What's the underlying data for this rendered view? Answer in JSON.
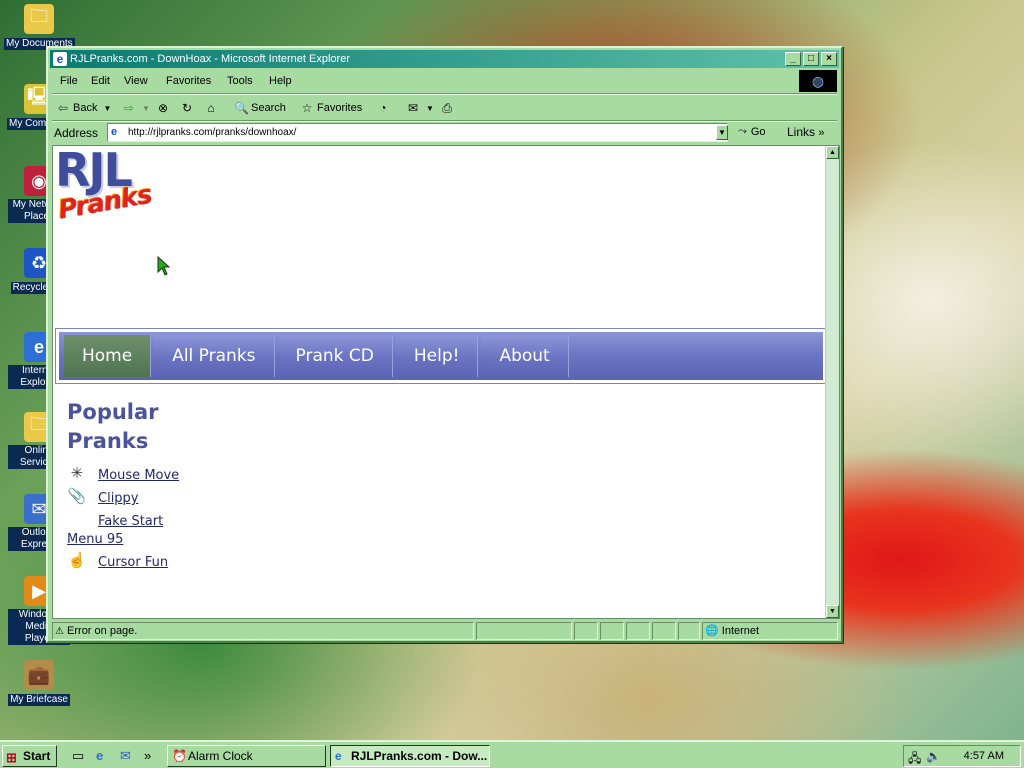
{
  "desktop": {
    "icons": [
      {
        "label": "My Documents",
        "icon": "folder-documents-icon",
        "color": "#e9c84a"
      },
      {
        "label": "My Computer",
        "icon": "computer-icon",
        "color": "#d9c436"
      },
      {
        "label": "My Network Places",
        "icon": "network-places-icon",
        "color": "#c0203a"
      },
      {
        "label": "Recycle Bin",
        "icon": "recycle-bin-icon",
        "color": "#1d56c4"
      },
      {
        "label": "Internet Explorer",
        "icon": "internet-explorer-icon",
        "color": "#2d6fd6"
      },
      {
        "label": "Online Services",
        "icon": "folder-icon",
        "color": "#e9c84a"
      },
      {
        "label": "Outlook Express",
        "icon": "outlook-express-icon",
        "color": "#3b6fc9"
      },
      {
        "label": "Windows Media Player",
        "icon": "media-player-icon",
        "color": "#e28a18"
      },
      {
        "label": "My Briefcase",
        "icon": "briefcase-icon",
        "color": "#b48c4a"
      }
    ]
  },
  "window": {
    "title": "RJLPranks.com - DownHoax - Microsoft Internet Explorer",
    "controls": {
      "minimize": "_",
      "maximize": "□",
      "close": "×"
    },
    "menu": [
      {
        "label": "File"
      },
      {
        "label": "Edit"
      },
      {
        "label": "View"
      },
      {
        "label": "Favorites"
      },
      {
        "label": "Tools"
      },
      {
        "label": "Help"
      }
    ],
    "toolbar": {
      "back": "Back",
      "search": "Search",
      "favorites": "Favorites"
    },
    "address": {
      "label": "Address",
      "url": "http://rjlpranks.com/pranks/downhoax/",
      "go": "Go",
      "links": "Links"
    },
    "status": {
      "text": "Error on page.",
      "zone": "Internet"
    }
  },
  "page": {
    "logo": {
      "line1": "RJL",
      "line2": "Pranks"
    },
    "nav": [
      {
        "label": "Home",
        "active": true
      },
      {
        "label": "All Pranks",
        "active": false
      },
      {
        "label": "Prank CD",
        "active": false
      },
      {
        "label": "Help!",
        "active": false
      },
      {
        "label": "About",
        "active": false
      }
    ],
    "section_title_line1": "Popular",
    "section_title_line2": "Pranks",
    "pranks": [
      {
        "label": "Mouse Move",
        "icon": "mouse-move-icon"
      },
      {
        "label": "Clippy",
        "icon": "paperclip-icon"
      },
      {
        "label": "Fake Start",
        "icon": ""
      },
      {
        "label": "Menu 95",
        "icon": ""
      },
      {
        "label": "Cursor Fun",
        "icon": "hand-cursor-icon"
      }
    ]
  },
  "taskbar": {
    "start": "Start",
    "tasks": [
      {
        "label": "Alarm Clock",
        "active": false
      },
      {
        "label": "RJLPranks.com - Dow...",
        "active": true
      }
    ],
    "clock": "4:57 AM"
  }
}
